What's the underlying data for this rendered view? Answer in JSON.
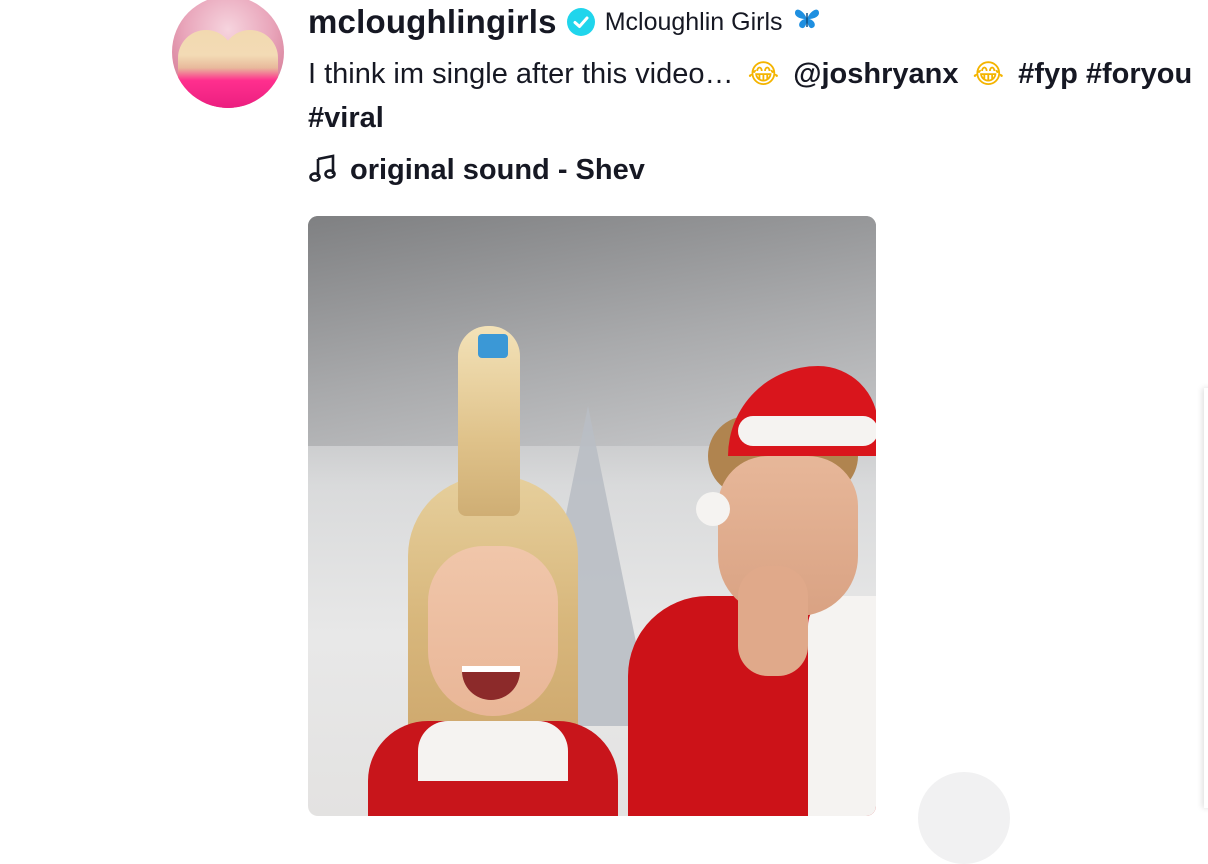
{
  "post": {
    "username": "mcloughlingirls",
    "display_name": "Mcloughlin Girls",
    "caption": {
      "text": "I think im single after this video…",
      "mention": "@joshryanx",
      "hashtags": [
        "#fyp",
        "#foryou"
      ],
      "hashtag_line2": "#viral"
    },
    "music": "original sound - Shev"
  },
  "icons": {
    "verified": "verified-badge-icon",
    "butterfly": "butterfly-emoji",
    "laugh": "tears-of-joy-emoji",
    "music": "music-note-icon"
  },
  "colors": {
    "verified": "#20d5ec",
    "text": "#161823",
    "butterfly": "#1f8fe0"
  }
}
